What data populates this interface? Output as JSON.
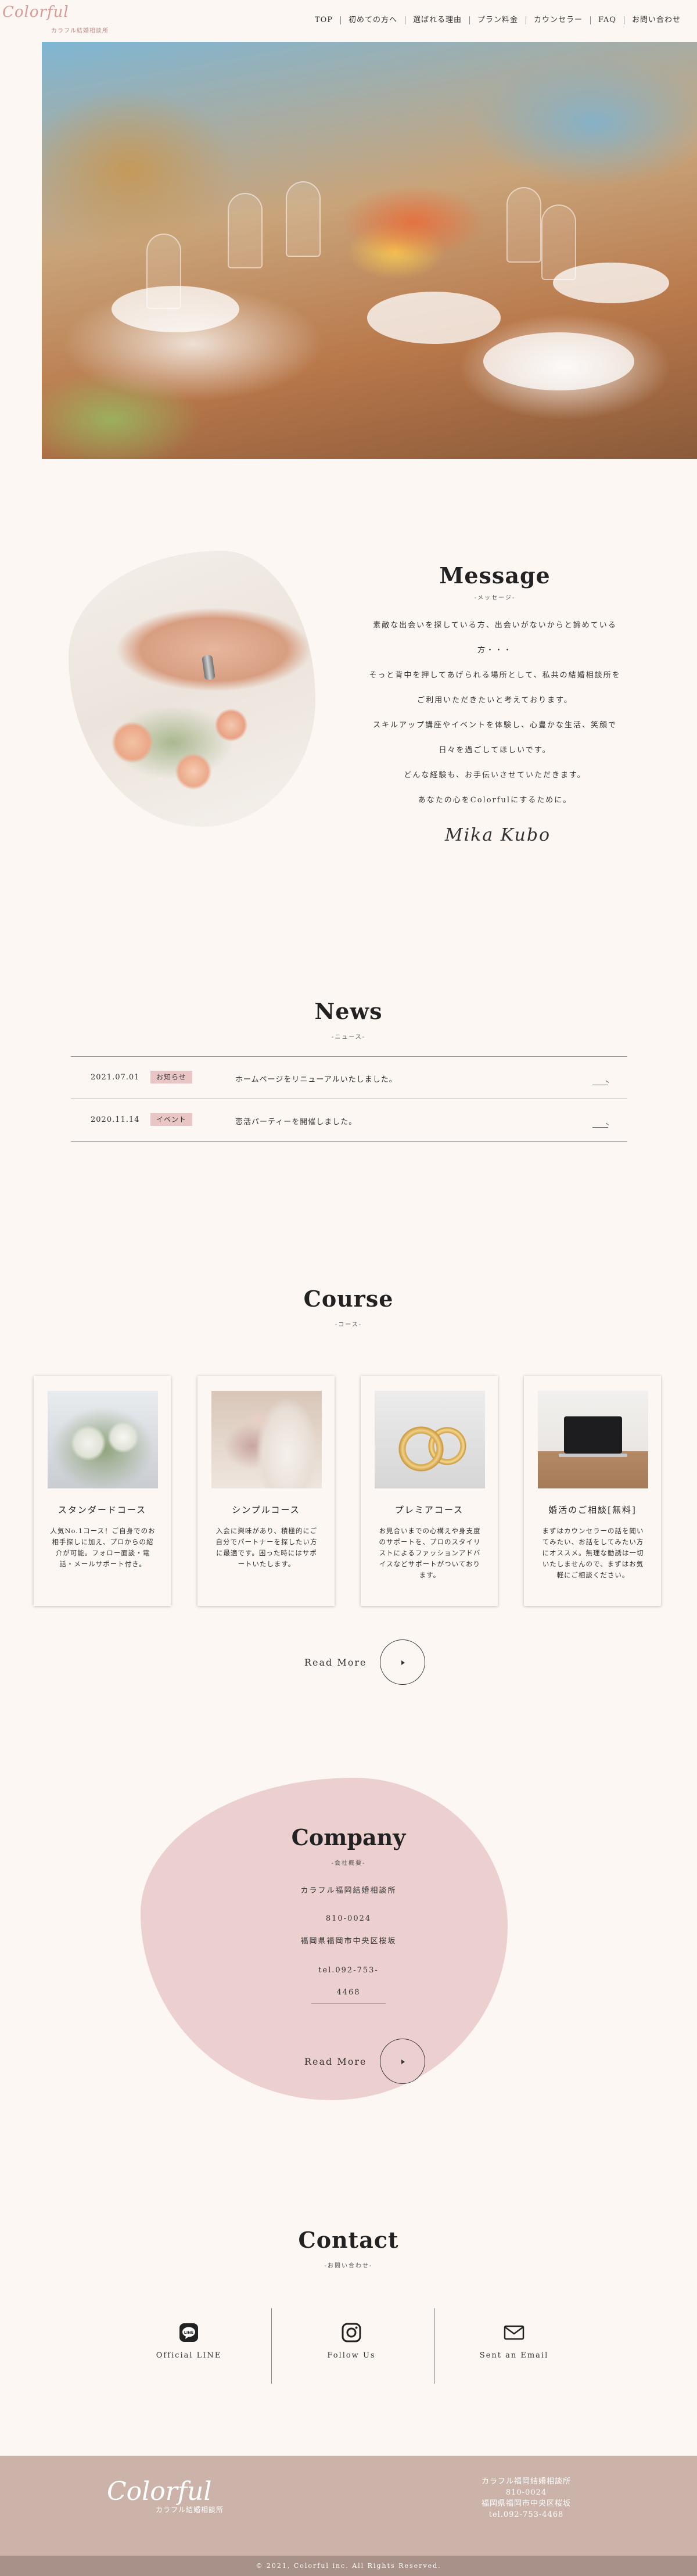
{
  "header": {
    "logo_script": "Colorful",
    "logo_sub": "カラフル結婚相談所",
    "nav": [
      "TOP",
      "初めての方へ",
      "選ばれる理由",
      "プラン料金",
      "カウンセラー",
      "FAQ",
      "お問い合わせ"
    ]
  },
  "message": {
    "title": "Message",
    "subtitle": "-メッセージ-",
    "lines": [
      "素敵な出会いを探している方、出会いがないからと諦めている",
      "方・・・",
      "そっと背中を押してあげられる場所として、私共の結婚相談所を",
      "ご利用いただきたいと考えております。",
      "スキルアップ講座やイベントを体験し、心豊かな生活、笑顔で",
      "日々を過ごしてほしいです。",
      "どんな経験も、お手伝いさせていただきます。",
      "あなたの心をColorfulにするために。"
    ],
    "signature": "Mika Kubo"
  },
  "news": {
    "title": "News",
    "subtitle": "-ニュース-",
    "items": [
      {
        "date": "2021.07.01",
        "tag": "お知らせ",
        "text": "ホームページをリニューアルいたしました。"
      },
      {
        "date": "2020.11.14",
        "tag": "イベント",
        "text": "恋活パーティーを開催しました。"
      }
    ]
  },
  "course": {
    "title": "Course",
    "subtitle": "-コース-",
    "cards": [
      {
        "name": "スタンダードコース",
        "desc": "人気No.1コース！ご自身でのお相手探しに加え、プロからの紹介が可能。フォロー面談・電話・メールサポート付き。"
      },
      {
        "name": "シンプルコース",
        "desc": "入会に興味があり、積極的にご自分でパートナーを探したい方に最適です。困った時にはサポートいたします。"
      },
      {
        "name": "プレミアコース",
        "desc": "お見合いまでの心構えや身支度のサポートを、プロのスタイリストによるファッションアドバイスなどサポートがついております。"
      },
      {
        "name": "婚活のご相談[無料]",
        "desc": "まずはカウンセラーの話を聞いてみたい、お話をしてみたい方にオススメ。無理な勧誘は一切いたしませんので、まずはお気軽にご相談ください。"
      }
    ],
    "read_more": "Read More"
  },
  "company": {
    "title": "Company",
    "subtitle": "-会社概要-",
    "name": "カラフル福岡結婚相談所",
    "zip": "810-0024",
    "address": "福岡県福岡市中央区桜坂",
    "tel_1": "tel.092-753-",
    "tel_2": "4468",
    "read_more": "Read More"
  },
  "contact": {
    "title": "Contact",
    "subtitle": "-お問い合わせ-",
    "items": [
      {
        "label": "Official LINE",
        "icon": "line-icon"
      },
      {
        "label": "Follow Us",
        "icon": "instagram-icon"
      },
      {
        "label": "Sent an Email",
        "icon": "mail-icon"
      }
    ]
  },
  "footer": {
    "logo_script": "Colorful",
    "logo_sub": "カラフル結婚相談所",
    "info": [
      "カラフル福岡結婚相談所",
      "810-0024",
      "福岡県福岡市中央区桜坂",
      "tel.092-753-4468"
    ],
    "copyright": "© 2021, Colorful inc. All Rights Reserved."
  }
}
